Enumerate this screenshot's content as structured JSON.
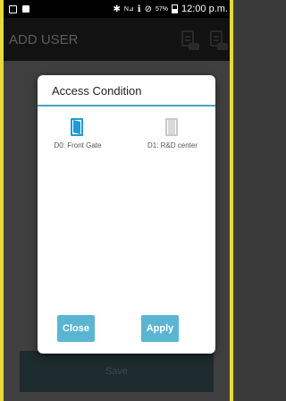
{
  "status_bar": {
    "bluetooth": "✱",
    "network": "N⊿",
    "wifi": "ℹ",
    "dnd": "⊘",
    "battery_pct": "57%",
    "time": "12:00 p.m."
  },
  "app_bar": {
    "title": "ADD USER",
    "actions": [
      {
        "icon": "document-id-icon"
      },
      {
        "icon": "document-add-icon"
      }
    ]
  },
  "dialog": {
    "title": "Access Condition",
    "doors": [
      {
        "label": "D0: Front Gate",
        "state": "selected"
      },
      {
        "label": "D1: R&D center",
        "state": "unselected"
      }
    ],
    "close_label": "Close",
    "apply_label": "Apply"
  },
  "footer": {
    "save_label": "Save"
  },
  "colors": {
    "accent": "#5ab5d3",
    "door_active": "#1f9bd7",
    "divider": "#4aa3bf"
  }
}
